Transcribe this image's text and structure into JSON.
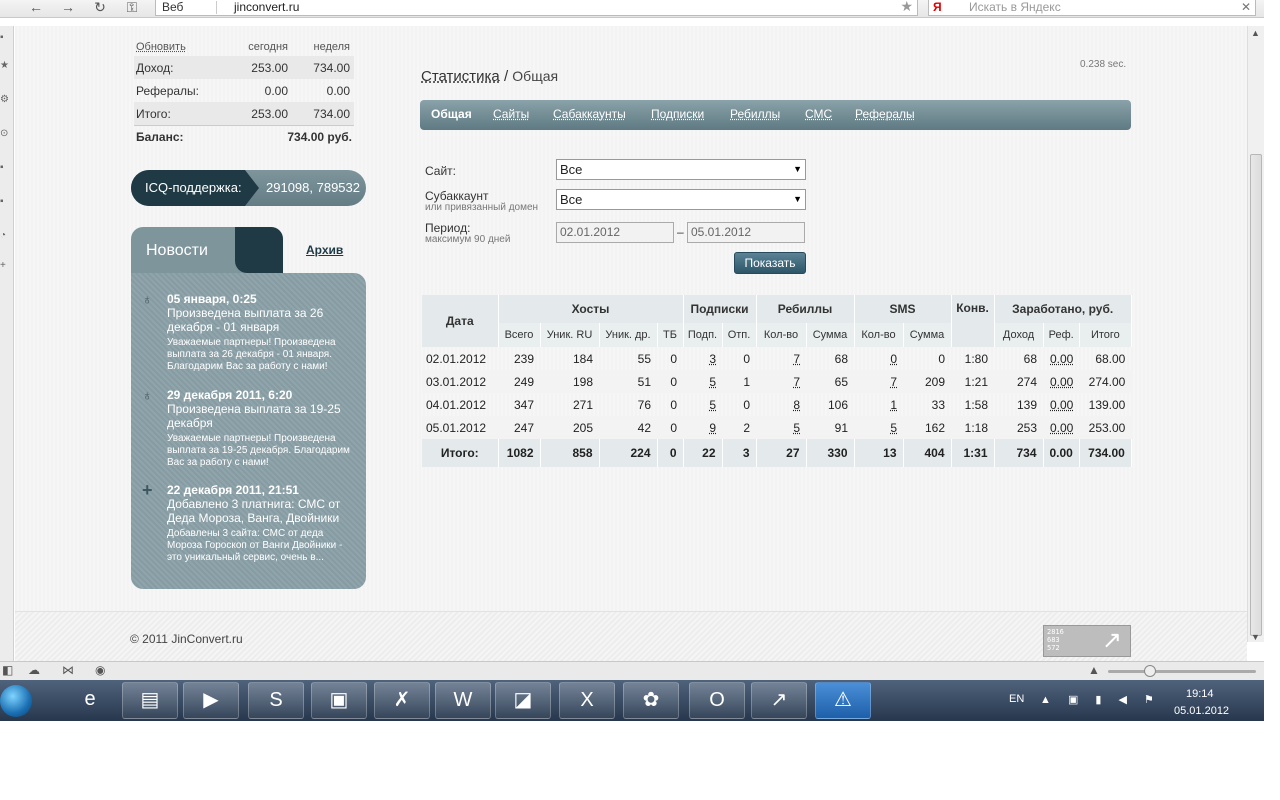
{
  "browser": {
    "web_label": "Веб",
    "url": "jinconvert.ru",
    "search_placeholder": "Искать в Яндекс",
    "search_engine": "Я"
  },
  "balance": {
    "refresh_label": "Обновить",
    "col_today": "сегодня",
    "col_week": "неделя",
    "rows": [
      {
        "label": "Доход:",
        "today": "253.00",
        "week": "734.00"
      },
      {
        "label": "Рефералы:",
        "today": "0.00",
        "week": "0.00"
      },
      {
        "label": "Итого:",
        "today": "253.00",
        "week": "734.00"
      }
    ],
    "balance_label": "Баланс:",
    "balance_value": "734.00 руб."
  },
  "icq": {
    "label": "ICQ-поддержка:",
    "numbers": "291098, 789532"
  },
  "news": {
    "title": "Новости",
    "archive": "Архив",
    "items": [
      {
        "date": "05 января, 0:25",
        "head": "Произведена выплата за 26 декабря - 01 января",
        "text": "Уважаемые партнеры! Произведена выплата за 26 декабря - 01 января. Благодарим Вас за работу с нами!"
      },
      {
        "date": "29 декабря 2011, 6:20",
        "head": "Произведена выплата за 19-25 декабря",
        "text": "Уважаемые партнеры! Произведена выплата за 19-25 декабря. Благодарим Вас за работу с нами!"
      },
      {
        "date": "22 декабря 2011, 21:51",
        "head": "Добавлено 3 платнига: СМС от Деда Мороза, Ванга, Двойники",
        "text": "Добавлены 3 сайта: СМС от деда Мороза Гороскоп от Ванги Двойники - это уникальный сервис, очень в..."
      }
    ]
  },
  "breadcrumb": {
    "section": "Статистика",
    "separator": " / ",
    "page": "Общая"
  },
  "timing": "0.238 sec.",
  "tabs": [
    "Общая",
    "Сайты",
    "Сабаккаунты",
    "Подписки",
    "Ребиллы",
    "СМС",
    "Рефералы"
  ],
  "filters": {
    "site_label": "Сайт:",
    "site_value": "Все",
    "subaccount_label": "Субаккаунт",
    "subaccount_hint": "или привязанный домен",
    "subaccount_value": "Все",
    "period_label": "Период:",
    "period_hint": "максимум 90 дней",
    "date_from": "02.01.2012",
    "date_dash": "–",
    "date_to": "05.01.2012",
    "show_button": "Показать"
  },
  "stats": {
    "group_headers": [
      "Дата",
      "Хосты",
      "Подписки",
      "Ребиллы",
      "SMS",
      "Конв.",
      "Заработано, руб."
    ],
    "sub_headers": [
      "Всего",
      "Уник. RU",
      "Уник. др.",
      "ТБ",
      "Подп.",
      "Отп.",
      "Кол-во",
      "Сумма",
      "Кол-во",
      "Сумма",
      "Доход",
      "Реф.",
      "Итого"
    ],
    "rows": [
      [
        "02.01.2012",
        "239",
        "184",
        "55",
        "0",
        "3",
        "0",
        "7",
        "68",
        "0",
        "0",
        "1:80",
        "68",
        "0.00",
        "68.00"
      ],
      [
        "03.01.2012",
        "249",
        "198",
        "51",
        "0",
        "5",
        "1",
        "7",
        "65",
        "7",
        "209",
        "1:21",
        "274",
        "0.00",
        "274.00"
      ],
      [
        "04.01.2012",
        "347",
        "271",
        "76",
        "0",
        "5",
        "0",
        "8",
        "106",
        "1",
        "33",
        "1:58",
        "139",
        "0.00",
        "139.00"
      ],
      [
        "05.01.2012",
        "247",
        "205",
        "42",
        "0",
        "9",
        "2",
        "5",
        "91",
        "5",
        "162",
        "1:18",
        "253",
        "0.00",
        "253.00"
      ]
    ],
    "total": [
      "Итого:",
      "1082",
      "858",
      "224",
      "0",
      "22",
      "3",
      "27",
      "330",
      "13",
      "404",
      "1:31",
      "734",
      "0.00",
      "734.00"
    ]
  },
  "footer": {
    "copyright": "© 2011 JinConvert.ru",
    "counter": [
      "2816",
      "683",
      "572"
    ]
  },
  "tray": {
    "lang": "EN",
    "time": "19:14",
    "date": "05.01.2012"
  }
}
